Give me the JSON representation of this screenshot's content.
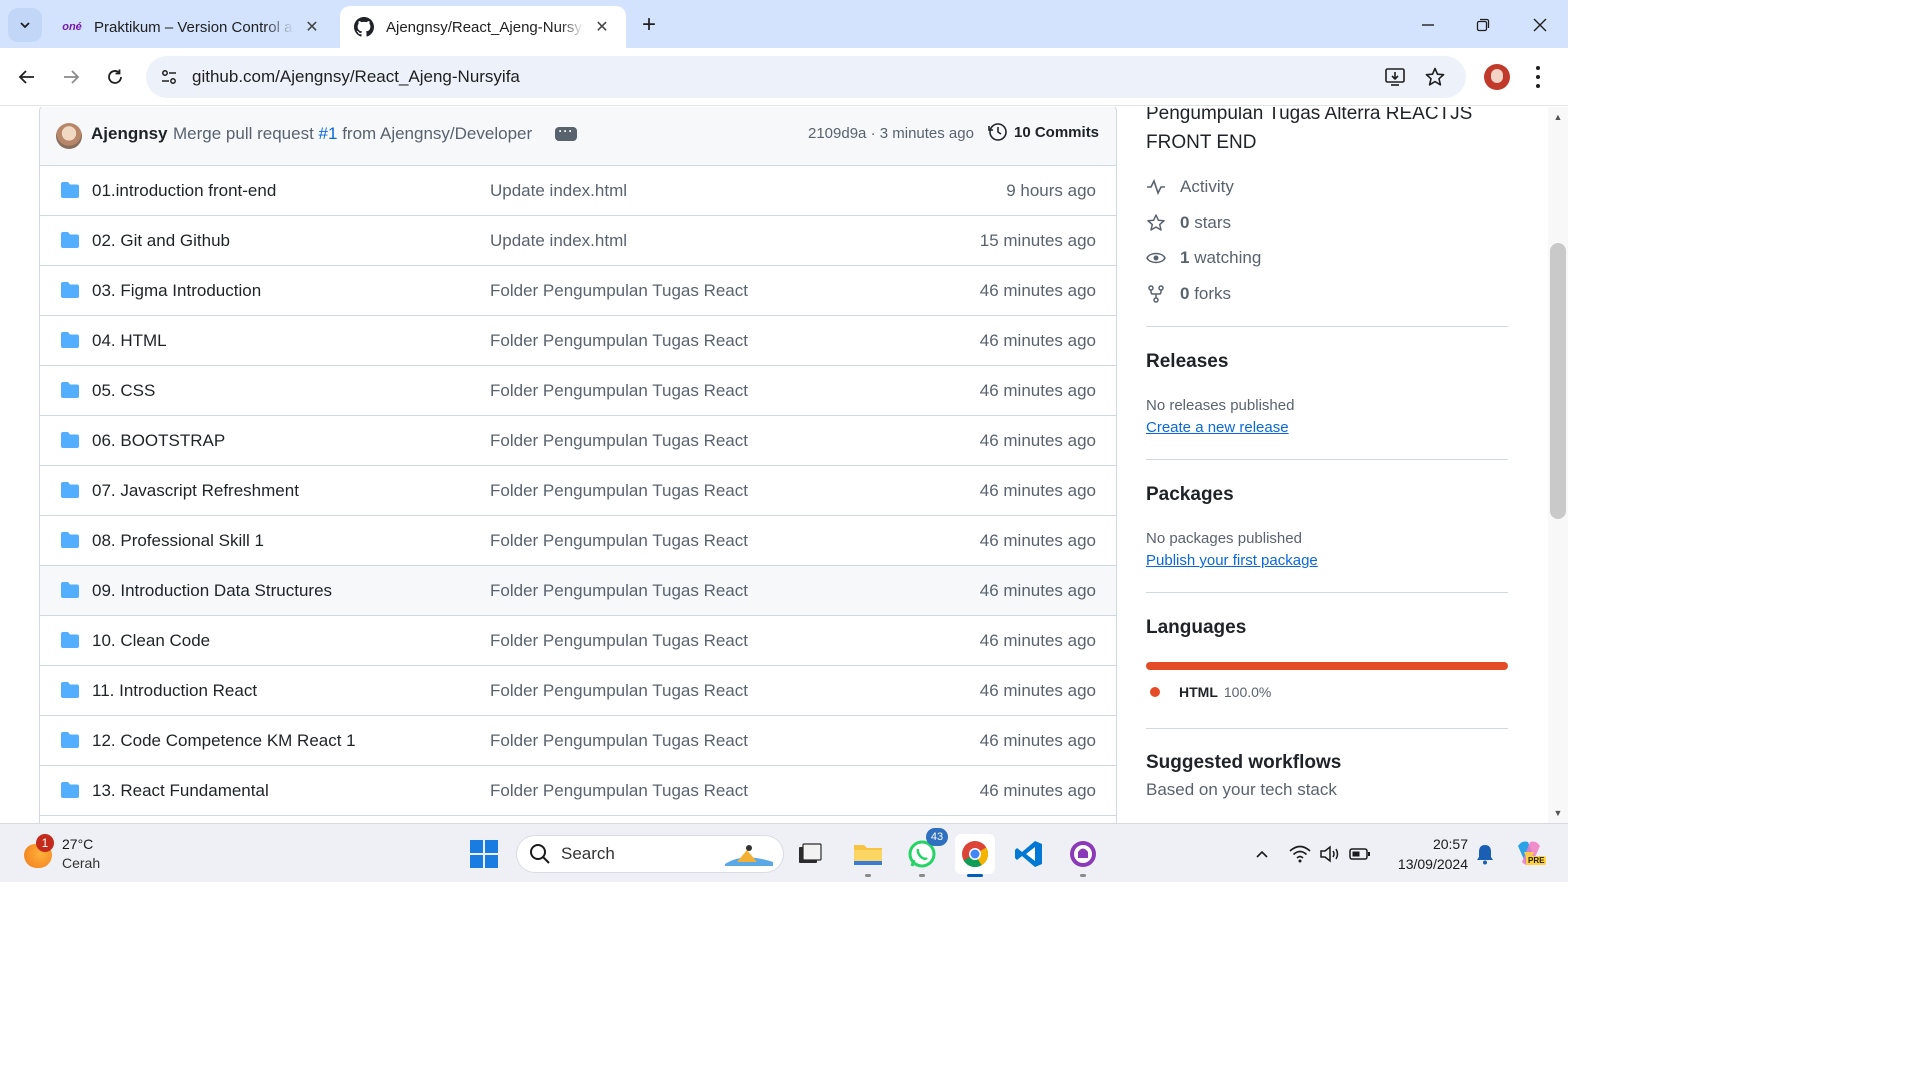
{
  "browser": {
    "tabs": [
      {
        "title": "Praktikum – Version Control and",
        "favicon": "onenote-favicon-icon",
        "favicon_text": "oné",
        "active": false
      },
      {
        "title": "Ajengnsy/React_Ajeng-Nursyifa",
        "favicon": "github-icon",
        "active": true
      }
    ],
    "url": "github.com/Ajengnsy/React_Ajeng-Nursyifa"
  },
  "repo": {
    "latest_commit": {
      "author": "Ajengnsy",
      "message_prefix": "Merge pull request",
      "pr_link": "#1",
      "message_suffix": "from Ajengnsy/Developer",
      "meta": "2109d9a · 3 minutes ago",
      "commits_label": "10 Commits"
    },
    "files": [
      {
        "name": "01.introduction front-end",
        "message": "Update index.html",
        "age": "9 hours ago"
      },
      {
        "name": "02. Git and Github",
        "message": "Update index.html",
        "age": "15 minutes ago"
      },
      {
        "name": "03. Figma Introduction",
        "message": "Folder Pengumpulan Tugas React",
        "age": "46 minutes ago"
      },
      {
        "name": "04. HTML",
        "message": "Folder Pengumpulan Tugas React",
        "age": "46 minutes ago"
      },
      {
        "name": "05. CSS",
        "message": "Folder Pengumpulan Tugas React",
        "age": "46 minutes ago"
      },
      {
        "name": "06. BOOTSTRAP",
        "message": "Folder Pengumpulan Tugas React",
        "age": "46 minutes ago"
      },
      {
        "name": "07. Javascript Refreshment",
        "message": "Folder Pengumpulan Tugas React",
        "age": "46 minutes ago"
      },
      {
        "name": "08. Professional Skill 1",
        "message": "Folder Pengumpulan Tugas React",
        "age": "46 minutes ago"
      },
      {
        "name": "09. Introduction Data Structures",
        "message": "Folder Pengumpulan Tugas React",
        "age": "46 minutes ago"
      },
      {
        "name": "10. Clean Code",
        "message": "Folder Pengumpulan Tugas React",
        "age": "46 minutes ago"
      },
      {
        "name": "11. Introduction React",
        "message": "Folder Pengumpulan Tugas React",
        "age": "46 minutes ago"
      },
      {
        "name": "12. Code Competence KM React 1",
        "message": "Folder Pengumpulan Tugas React",
        "age": "46 minutes ago"
      },
      {
        "name": "13. React Fundamental",
        "message": "Folder Pengumpulan Tugas React",
        "age": "46 minutes ago"
      }
    ],
    "hovered_row": 8
  },
  "sidebar": {
    "about_description": "Pengumpulan Tugas Alterra REACTJS FRONT END",
    "activity_label": "Activity",
    "stars_count": "0",
    "stars_label": "stars",
    "watching_count": "1",
    "watching_label": "watching",
    "forks_count": "0",
    "forks_label": "forks",
    "releases": {
      "heading": "Releases",
      "text": "No releases published",
      "link": "Create a new release"
    },
    "packages": {
      "heading": "Packages",
      "text": "No packages published",
      "link": "Publish your first package"
    },
    "languages": {
      "heading": "Languages",
      "items": [
        {
          "name": "HTML",
          "percent": "100.0%",
          "color": "#e34c26",
          "share": 100
        }
      ]
    },
    "workflows": {
      "heading": "Suggested workflows",
      "subtext": "Based on your tech stack"
    }
  },
  "taskbar": {
    "weather": {
      "temp": "27°C",
      "condition": "Cerah",
      "badge": "1"
    },
    "search_label": "Search",
    "whatsapp_badge": "43",
    "time": "20:57",
    "date": "13/09/2024",
    "copilot_badge": "PRE"
  },
  "colors": {
    "link": "#0969da",
    "muted": "#59636e",
    "folder": "#54aeff",
    "html_lang": "#e34c26",
    "tabstrip": "#d3e3fd"
  }
}
